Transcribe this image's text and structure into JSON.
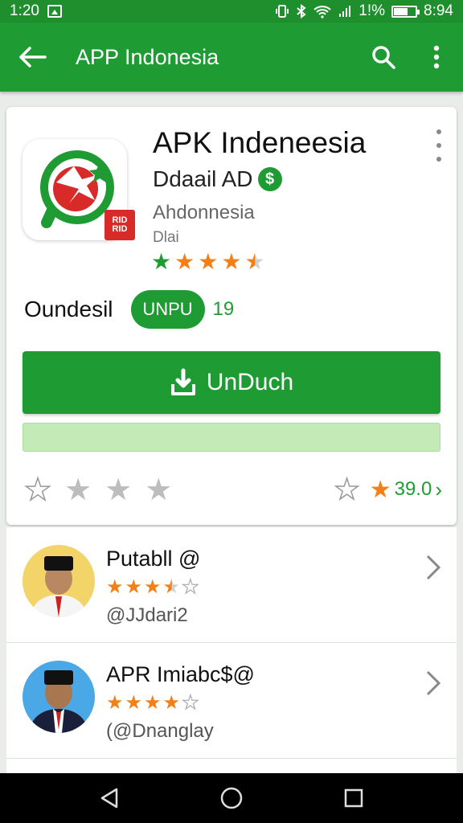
{
  "status_bar": {
    "time": "1:20",
    "battery_text": "1!%",
    "clock_right": "8:94"
  },
  "app_bar": {
    "title": "APP Indonesia"
  },
  "app": {
    "title": "APK Indeneesia",
    "developer": "Ddaail AD",
    "category": "Ahdonnesia",
    "meta": "Dlai",
    "badge": "RID RID",
    "rating_stars": 4.5,
    "size_label": "Oundesil",
    "size_chip": "UNPU",
    "size_count": "19",
    "install_label": "UnDuch",
    "progress_fraction": 1.0,
    "rate_value": "39.0"
  },
  "reviews": [
    {
      "name": "Putabll @",
      "stars": 3.5,
      "handle": "@JJdari2"
    },
    {
      "name": "APR Imiabc$@",
      "stars": 4.5,
      "handle": "(@Dnanglay"
    }
  ],
  "colors": {
    "primary": "#1f9b34",
    "status_bar": "#1f8f2e",
    "star": "#f37f16",
    "progress": "#cfeec5"
  },
  "icons": [
    "back-arrow-icon",
    "search-icon",
    "more-vert-icon",
    "download-icon",
    "star-icon",
    "chevron-right-icon",
    "nav-back-icon",
    "nav-home-icon",
    "nav-recents-icon"
  ]
}
